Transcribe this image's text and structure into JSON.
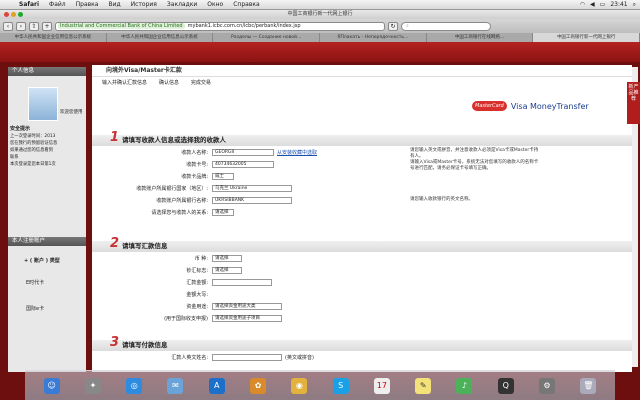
{
  "menubar": {
    "apple": "",
    "items": [
      "Safari",
      "Файл",
      "Правка",
      "Вид",
      "История",
      "Закладки",
      "Окно",
      "Справка"
    ],
    "clock": "23:41",
    "status_icons": [
      "battery-icon",
      "wifi-icon",
      "volume-icon",
      "search-icon"
    ]
  },
  "window": {
    "title": "中国工商银行新一代网上银行"
  },
  "toolbar": {
    "ssl_label": "Industrial and Commercial Bank of China Limited",
    "url": "mybank1.icbc.com.cn/icbc/perbank/index.jsp",
    "search_placeholder": ""
  },
  "tabs": [
    "中华人民共和国企业信用信息公示系统",
    "中华人民共和国企业信用信息公示系统",
    "Разделы — Создание новой...",
    "ЯПлакать - Непорядочность...",
    "中国工商银行在线网络...",
    "中国工商银行新一代网上银行"
  ],
  "left": {
    "personal_info": "个人信息",
    "welcome": "欢迎您使用",
    "security": "安全提示",
    "tips": [
      "上一次登录时间：2013",
      "您在我行的预留验证信息",
      "如果通过您的信息看到",
      "联系",
      "本次登录是您本日第1次"
    ],
    "accounts": "本人注册账户",
    "account_type": "+ ( 账户 ) 类型",
    "card1": "E时代卡",
    "card2": "国际e卡"
  },
  "page": {
    "title": "向境外Visa/Master卡汇款",
    "steps": [
      "输入并确认汇款信息",
      "确认信息",
      "完成交易"
    ],
    "brand": "Visa MoneyTransfer",
    "mc": "MasterCard"
  },
  "s1": {
    "num": "1",
    "title": "请填写收款人信息或选择我的收款人",
    "name_label": "收款人名称:",
    "name_value": "GEORGII",
    "name_link": "从安装收藏中选取",
    "card_label": "收款卡号:",
    "card_value": "40734632005",
    "cardorg_label": "收款卡品牌:",
    "cardorg_value": "威士",
    "country_label": "收款账户所属银行国家（地区）:",
    "country_value": "乌克兰 Ukraine",
    "bank_label": "收款账户所属银行名称:",
    "bank_value": "UKRSIBBANK",
    "rel_label": "请选择您与收款人的关系:",
    "rel_value": "请选择",
    "note1": "请您输入英文或拼音，并注意收款人必须是Visa卡或Master卡持有人。",
    "note2": "请输入Visa或Master卡号，系统无法对您填写的收款人的名称卡号进行匹配，请务必保证卡号填写正确。",
    "note3": "请您输入收款银行的英文名称。"
  },
  "s2": {
    "num": "2",
    "title": "请填写汇款信息",
    "currency_label": "币  种:",
    "currency_value": "请选择",
    "cashflag_label": "钞汇标志:",
    "cashflag_value": "请选择",
    "amount_label": "汇款金额:",
    "amount_value": "",
    "fee_label": "金额大写:",
    "fee_value": "",
    "purpose_label": "资金用途:",
    "purpose_value": "请选择资金用途大类",
    "purpose2_label": "(用于国际收支申报)",
    "purpose2_value": "请选择资金用途子项目"
  },
  "s3": {
    "num": "3",
    "title": "请填写付款信息",
    "payer_label": "汇款人英文姓名:",
    "payer_hint": "(英文或拼音)"
  },
  "sidetab": "新产品推荐",
  "dock": {
    "items": [
      "finder-icon",
      "launchpad-icon",
      "safari-icon",
      "mail-icon",
      "appstore-icon",
      "photos-icon",
      "chrome-icon",
      "skype-icon",
      "calendar-icon",
      "notes-icon",
      "music-icon",
      "qq-icon",
      "settings-icon",
      "trash-icon"
    ]
  }
}
